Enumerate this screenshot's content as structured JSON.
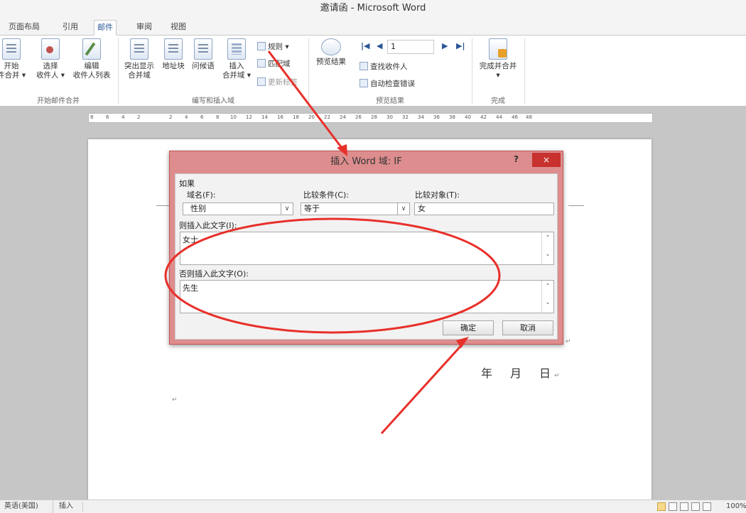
{
  "window": {
    "title": "邀请函 - Microsoft Word"
  },
  "tabs": [
    "页面布局",
    "引用",
    "邮件",
    "审阅",
    "视图"
  ],
  "active_tab": "邮件",
  "ribbon": {
    "start_group": {
      "start_label_1": "开始",
      "start_label_2": "件合并 ▾",
      "select_label_1": "选择",
      "select_label_2": "收件人 ▾",
      "edit_label_1": "编辑",
      "edit_label_2": "收件人列表",
      "group_label": "开始邮件合并"
    },
    "write_group": {
      "highlight_1": "突出显示",
      "highlight_2": "合并域",
      "address_block": "地址块",
      "greeting": "问候语",
      "insert_1": "插入",
      "insert_2": "合并域 ▾",
      "rules": "规则 ▾",
      "match_fields": "匹配域",
      "update_labels": "更新标签",
      "group_label": "编写和插入域"
    },
    "preview_group": {
      "preview_results": "预览结果",
      "record_number": "1",
      "find_recipient": "查找收件人",
      "auto_check": "自动检查错误",
      "group_label": "预览结果"
    },
    "finish_group": {
      "finish_merge": "完成并合并",
      "finish_arrow": "▾",
      "group_label": "完成"
    }
  },
  "ruler": {
    "ticks": [
      "8",
      "6",
      "4",
      "2",
      "2",
      "4",
      "6",
      "8",
      "10",
      "12",
      "14",
      "16",
      "18",
      "20",
      "22",
      "24",
      "26",
      "28",
      "30",
      "32",
      "34",
      "36",
      "38",
      "40",
      "42",
      "44",
      "46",
      "48"
    ]
  },
  "document": {
    "date_year": "年",
    "date_month": "月",
    "date_day": "日",
    "para_mark": "↵"
  },
  "dialog": {
    "title": "插入 Word 域: IF",
    "help": "?",
    "close": "×",
    "if_label": "如果",
    "field_name_label": "域名(F):",
    "field_name_value": "性别",
    "comparison_label": "比较条件(C):",
    "comparison_value": "等于",
    "compare_to_label": "比较对象(T):",
    "compare_to_value": "女",
    "insert_text_label": "则插入此文字(I):",
    "insert_text_value": "女士",
    "otherwise_label": "否则插入此文字(O):",
    "otherwise_value": "先生",
    "ok_button": "确定",
    "cancel_button": "取消",
    "scroll_up": "˄",
    "scroll_down": "˅",
    "dropdown_arrow": "∨"
  },
  "status_bar": {
    "language": "英语(美国)",
    "insert_mode": "插入",
    "zoom": "100%"
  },
  "colors": {
    "annotation": "#e8302a",
    "dialog_frame": "#dd8d8d",
    "close_button": "#c7312e",
    "active_tab_text": "#2b5797"
  }
}
